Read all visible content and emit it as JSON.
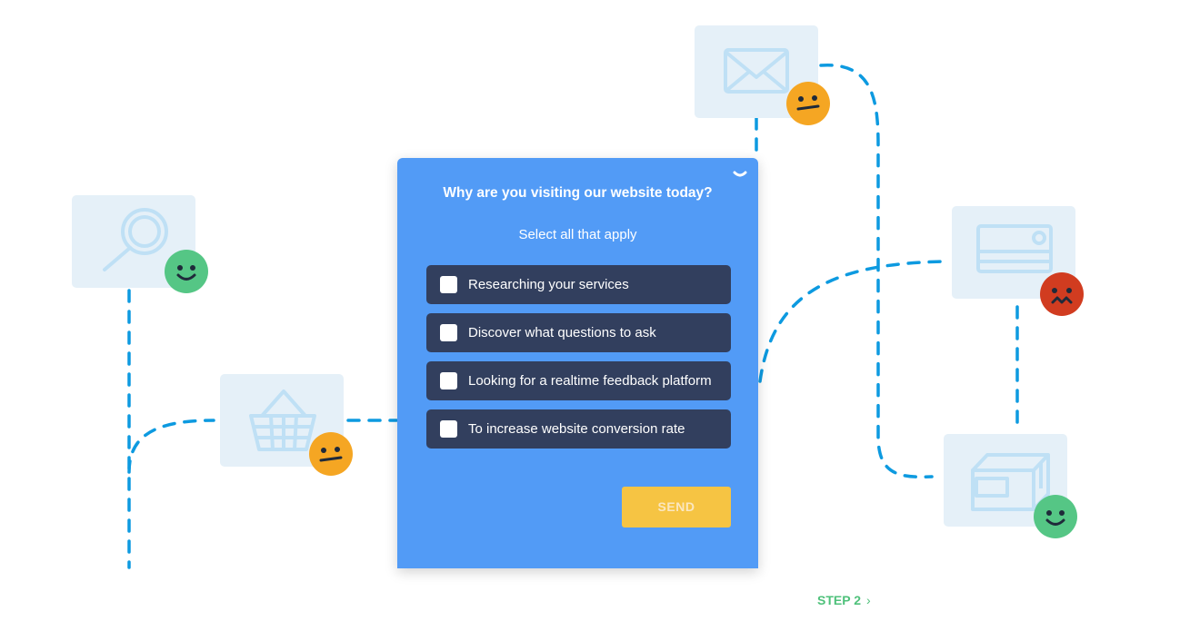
{
  "colors": {
    "widget_bg": "#529bf6",
    "option_bg": "#323f5e",
    "send_bg": "#f6c443",
    "line": "#0d9ae0",
    "tile_bg": "#e5f0f8",
    "icon": "#bfe0f5",
    "face_happy": "#55c685",
    "face_neutral": "#f5a623",
    "face_sad": "#d13c20",
    "step": "#4fc17b"
  },
  "illustration": {
    "tiles": [
      {
        "icon": "search-icon",
        "face": "happy"
      },
      {
        "icon": "basket-icon",
        "face": "neutral"
      },
      {
        "icon": "envelope-icon",
        "face": "neutral"
      },
      {
        "icon": "credit-card-icon",
        "face": "sad"
      },
      {
        "icon": "package-icon",
        "face": "happy"
      }
    ]
  },
  "survey": {
    "collapse_icon": "chevron-down-icon",
    "title": "Why are you visiting our website today?",
    "subtitle": "Select all that apply",
    "options": [
      {
        "label": "Researching your services",
        "checked": false
      },
      {
        "label": "Discover what questions to ask",
        "checked": false
      },
      {
        "label": "Looking for a realtime feedback platform",
        "checked": false
      },
      {
        "label": "To increase website conversion rate",
        "checked": false
      }
    ],
    "send_label": "SEND"
  },
  "step_nav": {
    "label": "STEP 2",
    "icon": "chevron-right-icon",
    "glyph": "›"
  }
}
